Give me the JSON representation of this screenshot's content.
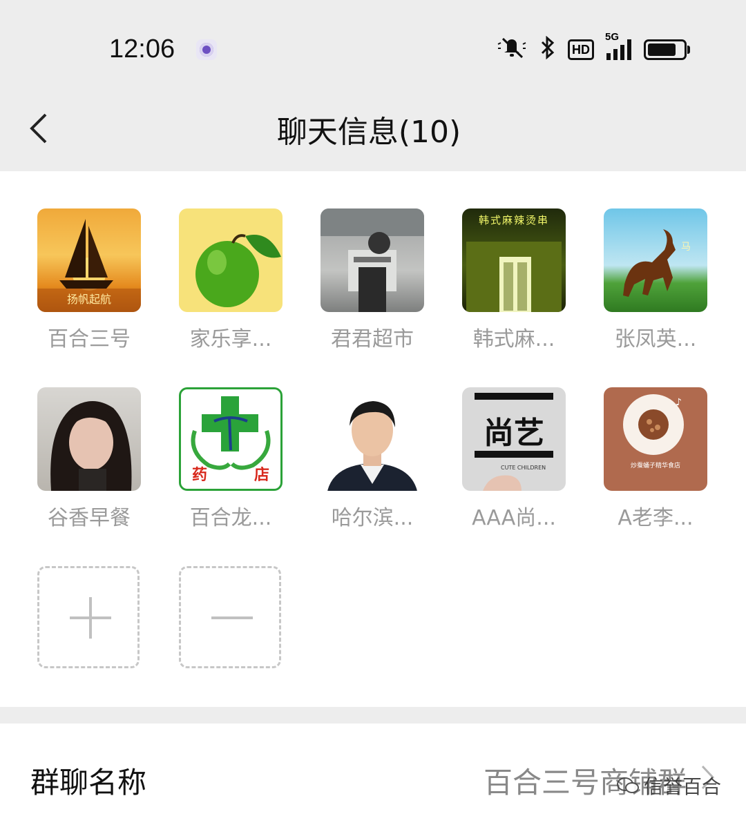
{
  "status_bar": {
    "time": "12:06",
    "icons": [
      "app-notification-icon",
      "mute-icon",
      "bluetooth-icon",
      "hd-icon",
      "signal-5g-icon",
      "battery-icon"
    ],
    "hd_label": "HD",
    "network_label": "5G"
  },
  "header": {
    "title": "聊天信息(10)",
    "back_icon": "back-chevron-icon"
  },
  "members": [
    {
      "name": "百合三号"
    },
    {
      "name": "家乐享..."
    },
    {
      "name": "君君超市"
    },
    {
      "name": "韩式麻..."
    },
    {
      "name": "张凤英..."
    },
    {
      "name": "谷香早餐"
    },
    {
      "name": "百合龙..."
    },
    {
      "name": "哈尔滨..."
    },
    {
      "name": "AAA尚..."
    },
    {
      "name": "A老李..."
    }
  ],
  "avatar_text": {
    "sailboat": "扬帆起航",
    "korean": "韩式麻辣烫串",
    "pharmacy_left": "药",
    "pharmacy_right": "店",
    "shangyi": "尚艺",
    "shangyi_sub": "CUTE CHILDREN",
    "qr_caption": "炒蚕蛹子精华食店"
  },
  "actions": {
    "add_icon": "plus-icon",
    "remove_icon": "minus-icon"
  },
  "settings": {
    "group_name_label": "群聊名称",
    "group_name_value": "百合三号商铺群"
  },
  "watermark": {
    "text": "信誉百合"
  },
  "colors": {
    "header_bg": "#ededed",
    "member_name": "#9a9a9a",
    "value_text": "#888888"
  }
}
